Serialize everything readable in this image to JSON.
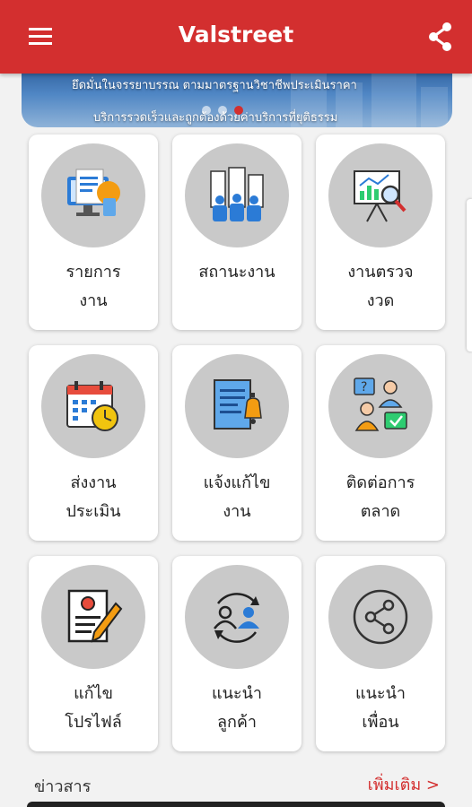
{
  "app": {
    "title": "Valstreet"
  },
  "banner": {
    "line1": "ยึดมั่นในจรรยาบรรณ ตามมาตรฐานวิชาชีพประเมินราคา",
    "line2": "บริการรวดเร็วและถูกต้องด้วยค่าบริการที่ยุติธรรม",
    "slide_count": 3,
    "active_slide": 3
  },
  "menu": [
    {
      "line1": "รายการ",
      "line2": "งาน",
      "icon": "task-list-icon"
    },
    {
      "line1": "สถานะงาน",
      "line2": "",
      "icon": "team-status-icon"
    },
    {
      "line1": "งานตรวจ",
      "line2": "งวด",
      "icon": "inspection-chart-icon"
    },
    {
      "line1": "ส่งงาน",
      "line2": "ประเมิน",
      "icon": "calendar-clock-icon"
    },
    {
      "line1": "แจ้งแก้ไข",
      "line2": "งาน",
      "icon": "document-bell-icon"
    },
    {
      "line1": "ติดต่อการ",
      "line2": "ตลาด",
      "icon": "contact-marketing-icon"
    },
    {
      "line1": "แก้ไข",
      "line2": "โปรไฟล์",
      "icon": "edit-profile-icon"
    },
    {
      "line1": "แนะนำ",
      "line2": "ลูกค้า",
      "icon": "refer-customer-icon"
    },
    {
      "line1": "แนะนำ",
      "line2": "เพื่อน",
      "icon": "share-friend-icon"
    }
  ],
  "news": {
    "title": "ข่าวสาร",
    "more": "เพิ่มเติม >"
  },
  "colors": {
    "primary": "#d32f2f",
    "circle_bg": "#c9c9c9"
  }
}
